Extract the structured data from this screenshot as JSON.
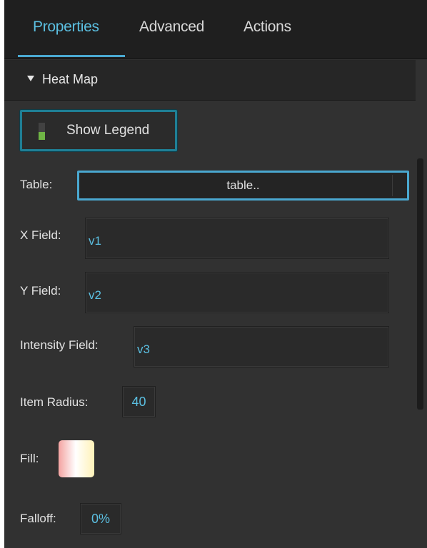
{
  "tabs": [
    {
      "label": "Properties",
      "active": true
    },
    {
      "label": "Advanced",
      "active": false
    },
    {
      "label": "Actions",
      "active": false
    }
  ],
  "section": {
    "title": "Heat Map",
    "expanded": true
  },
  "show_legend": {
    "label": "Show Legend",
    "checked": true
  },
  "table": {
    "label": "Table:",
    "button_text": "table.."
  },
  "x_field": {
    "label": "X Field:",
    "value": "v1"
  },
  "y_field": {
    "label": "Y Field:",
    "value": "v2"
  },
  "intensity_field": {
    "label": "Intensity Field:",
    "value": "v3"
  },
  "item_radius": {
    "label": "Item Radius:",
    "value": "40"
  },
  "fill": {
    "label": "Fill:",
    "gradient": [
      "#f4a3a1",
      "#ffffff",
      "#fff2b8"
    ]
  },
  "falloff": {
    "label": "Falloff:",
    "value": "0%"
  },
  "colors": {
    "accent": "#5bbfe1",
    "panel": "#313131",
    "toggle_border": "#1f7f95",
    "check_on": "#6fb445"
  }
}
